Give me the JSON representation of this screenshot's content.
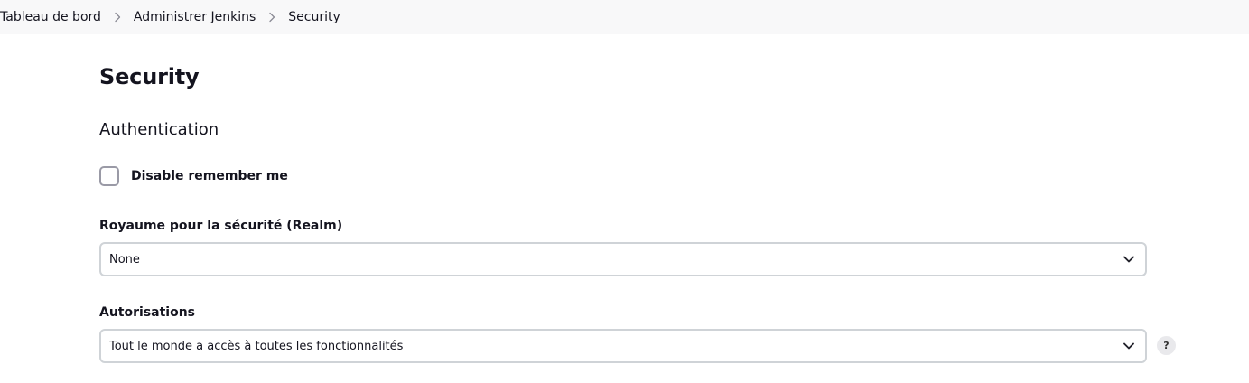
{
  "breadcrumb": {
    "items": [
      {
        "label": "Tableau de bord"
      },
      {
        "label": "Administrer Jenkins"
      },
      {
        "label": "Security"
      }
    ],
    "separator_icon": "chevron-right-icon"
  },
  "page": {
    "title": "Security"
  },
  "authentication": {
    "section_title": "Authentication",
    "disable_remember_me": {
      "label": "Disable remember me",
      "checked": false
    }
  },
  "realm": {
    "label": "Royaume pour la sécurité (Realm)",
    "selected": "None"
  },
  "authorization": {
    "label": "Autorisations",
    "selected": "Tout le monde a accès à toutes les fonctionnalités",
    "help_label": "?"
  },
  "icons": {
    "dropdown": "chevron-down-icon",
    "help": "help-icon"
  },
  "colors": {
    "breadcrumb_background": "#f8f8f9",
    "text": "#14141f",
    "input_border": "#cfd3d7",
    "checkbox_border": "#9a9aa6",
    "help_background": "#e9e9ec"
  }
}
